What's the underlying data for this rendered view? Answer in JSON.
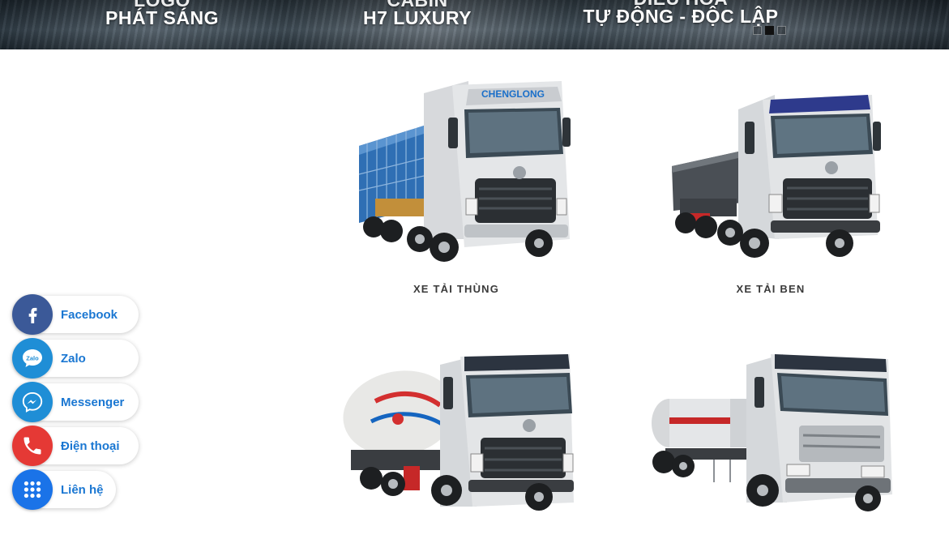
{
  "banner": {
    "captions": [
      {
        "line1": "LOGO",
        "line2": "PHÁT SÁNG"
      },
      {
        "line1": "CABIN",
        "line2": "H7 LUXURY"
      },
      {
        "line1": "ĐIỀU HÒA",
        "line2": "TỰ ĐỘNG - ĐỘC LẬP"
      }
    ],
    "active_slide": 2,
    "slide_count": 3
  },
  "products": [
    {
      "name": "XE TẢI THÙNG",
      "cab_brand": "CHENGLONG"
    },
    {
      "name": "XE TẢI BEN"
    },
    {
      "name": ""
    },
    {
      "name": ""
    }
  ],
  "contact": [
    {
      "label": "Facebook",
      "icon": "facebook-icon",
      "color": "#3b5998"
    },
    {
      "label": "Zalo",
      "icon": "zalo-icon",
      "color": "#1f8ed6"
    },
    {
      "label": "Messenger",
      "icon": "messenger-icon",
      "color": "#1f8ed6"
    },
    {
      "label": "Điện thoại",
      "icon": "phone-icon",
      "color": "#e53935"
    },
    {
      "label": "Liên hệ",
      "icon": "grid-menu-icon",
      "color": "#1a73e8"
    }
  ],
  "colors": {
    "label_text": "#1a77d2",
    "product_title": "#3a3a3a"
  }
}
